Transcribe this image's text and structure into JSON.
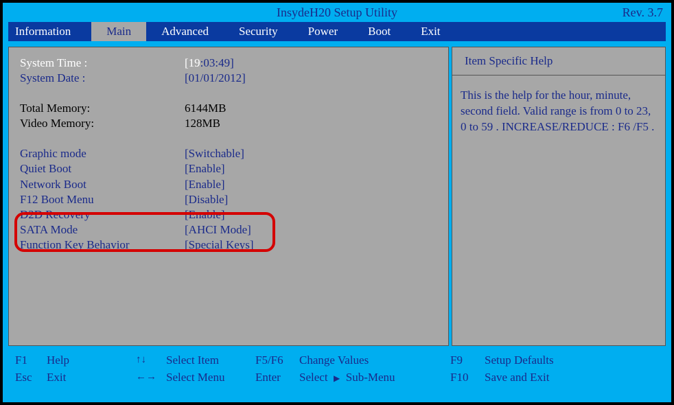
{
  "titlebar": {
    "title": "InsydeH20 Setup Utility",
    "rev": "Rev. 3.7"
  },
  "tabs": {
    "information": "Information",
    "main": "Main",
    "advanced": "Advanced",
    "security": "Security",
    "power": "Power",
    "boot": "Boot",
    "exit": "Exit"
  },
  "main": {
    "systemTimeLabel": "System Time :",
    "systemTimeHour": "[19",
    "systemTimeRest": ":03:49]",
    "systemDateLabel": "System Date :",
    "systemDateValue": "[01/01/2012]",
    "totalMemoryLabel": "Total Memory:",
    "totalMemoryValue": "6144MB",
    "videoMemoryLabel": "Video Memory:",
    "videoMemoryValue": "128MB",
    "graphicModeLabel": "Graphic mode",
    "graphicModeValue": "[Switchable]",
    "quietBootLabel": "Quiet Boot",
    "quietBootValue": "[Enable]",
    "networkBootLabel": "Network Boot",
    "networkBootValue": "[Enable]",
    "f12BootLabel": "F12 Boot Menu",
    "f12BootValue": "[Disable]",
    "d2dLabel": "D2D Recovery",
    "d2dValue": "[Enable]",
    "sataLabel": "SATA Mode",
    "sataValue": "[AHCI Mode]",
    "fnKeyLabel": "Function Key Behavior",
    "fnKeyValue": "[Special Keys]"
  },
  "help": {
    "title": "Item Specific Help",
    "body": "This is the help for the hour, minute, second field. Valid range is from 0 to 23, 0 to 59 . INCREASE/REDUCE : F6 /F5 ."
  },
  "footer": {
    "f1": "F1",
    "help": "Help",
    "selectItem": "Select Item",
    "f5f6": "F5/F6",
    "changeValues": "Change Values",
    "f9": "F9",
    "setupDefaults": "Setup Defaults",
    "esc": "Esc",
    "exit": "Exit",
    "selectMenu": "Select Menu",
    "enter": "Enter",
    "select": "Select",
    "subMenu": "Sub-Menu",
    "f10": "F10",
    "saveExit": "Save and Exit"
  }
}
